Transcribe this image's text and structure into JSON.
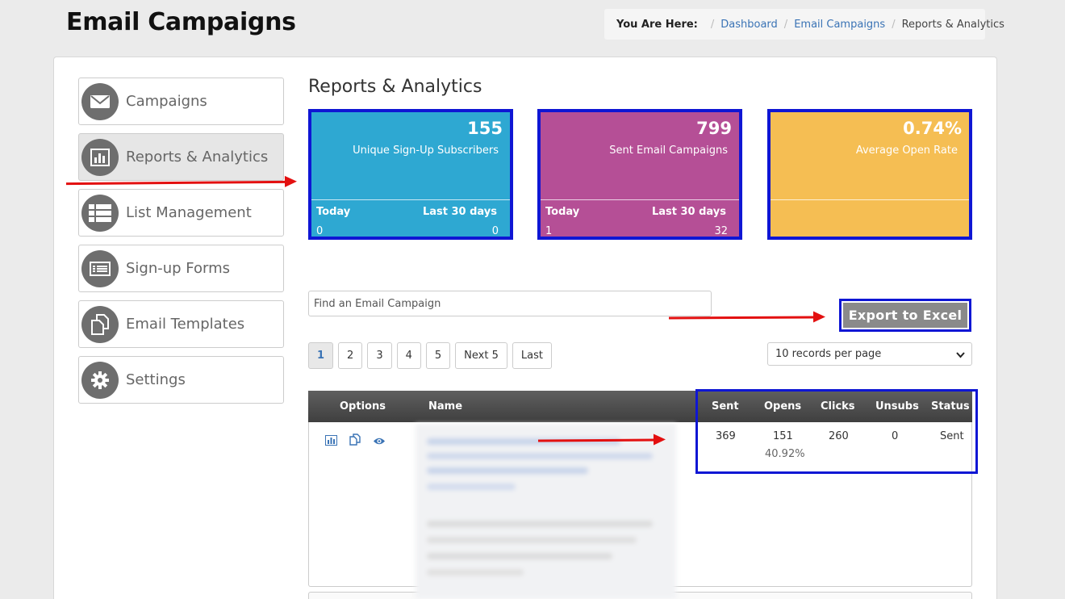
{
  "header": {
    "title": "Email Campaigns"
  },
  "breadcrumb": {
    "label": "You Are Here:",
    "items": [
      "Dashboard",
      "Email Campaigns",
      "Reports & Analytics"
    ]
  },
  "sidebar": {
    "items": [
      {
        "label": "Campaigns",
        "icon": "envelope-icon"
      },
      {
        "label": "Reports & Analytics",
        "icon": "bar-chart-icon",
        "active": true
      },
      {
        "label": "List Management",
        "icon": "list-icon"
      },
      {
        "label": "Sign-up Forms",
        "icon": "form-icon"
      },
      {
        "label": "Email Templates",
        "icon": "copy-icon"
      },
      {
        "label": "Settings",
        "icon": "gear-icon"
      }
    ]
  },
  "main": {
    "title": "Reports & Analytics",
    "stats": [
      {
        "value": "155",
        "caption": "Unique Sign-Up Subscribers",
        "today_label": "Today",
        "last_label": "Last 30 days",
        "today": "0",
        "last": "0",
        "color": "#2ea8d2"
      },
      {
        "value": "799",
        "caption": "Sent Email Campaigns",
        "today_label": "Today",
        "last_label": "Last 30 days",
        "today": "1",
        "last": "32",
        "color": "#b54f96"
      },
      {
        "value": "0.74%",
        "caption": "Average Open Rate",
        "color": "#f5be53"
      }
    ],
    "search": {
      "placeholder": "Find an Email Campaign"
    },
    "export_label": "Export to Excel",
    "pagination": [
      "1",
      "2",
      "3",
      "4",
      "5",
      "Next 5",
      "Last"
    ],
    "per_page": "10 records per page",
    "table": {
      "columns": [
        "Options",
        "Name",
        "Sent",
        "Opens",
        "Clicks",
        "Unsubs",
        "Status"
      ],
      "rows": [
        {
          "sent": "369",
          "opens": "151",
          "open_rate": "40.92%",
          "clicks": "260",
          "unsubs": "0",
          "status": "Sent"
        }
      ]
    }
  },
  "colors": {
    "highlight": "#0f16d4",
    "arrow": "#e31010",
    "link": "#3a73b5"
  }
}
